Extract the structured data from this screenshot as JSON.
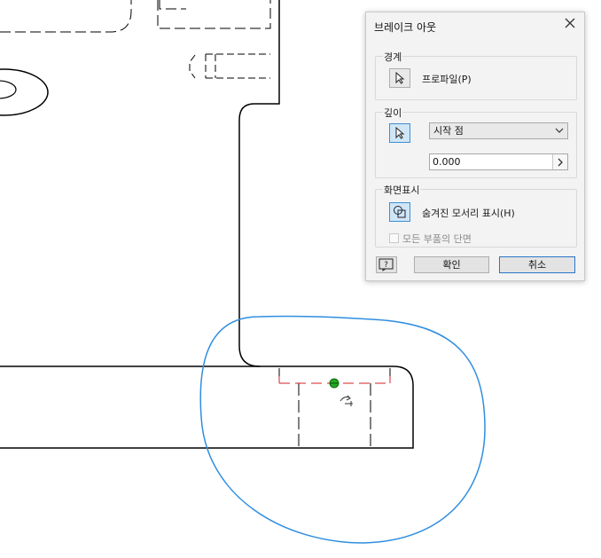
{
  "dialog": {
    "title": "브레이크 아웃",
    "boundary": {
      "group_label": "경계",
      "profile_label": "프로파일(P)"
    },
    "depth": {
      "group_label": "깊이",
      "selected_option": "시작 점",
      "value": "0.000"
    },
    "display": {
      "group_label": "화면표시",
      "hidden_edges_label": "숨겨진 모서리 표시(H)",
      "all_parts_section_label": "모든 부품의 단면",
      "all_parts_section_checked": false
    },
    "buttons": {
      "help_label": "?",
      "ok_label": "확인",
      "cancel_label": "취소"
    }
  },
  "colors": {
    "boundary_sketch": "#2f8ee0",
    "cut_line": "#d42020",
    "point_marker": "#22aa22",
    "geometry": "#000000"
  }
}
